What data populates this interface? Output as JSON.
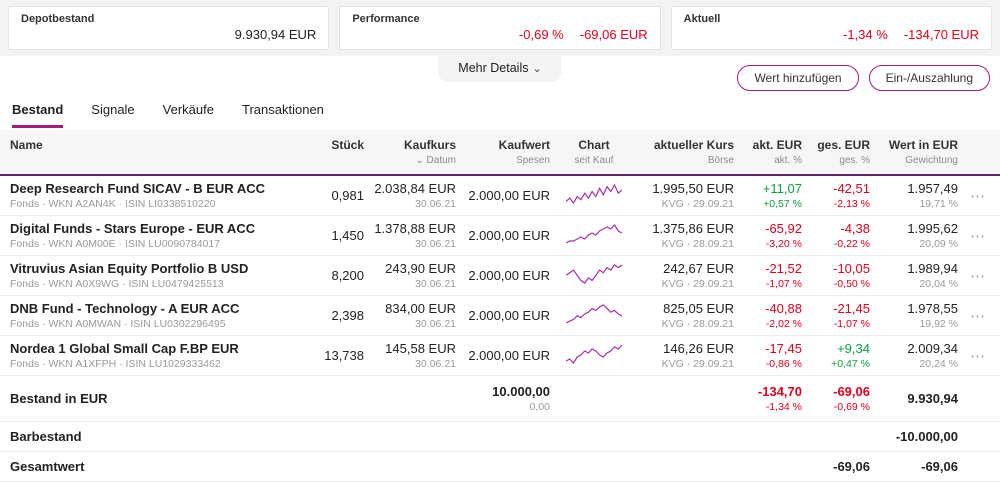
{
  "colors": {
    "accent": "#a61c7d",
    "positive": "#0aa13b",
    "negative": "#e2001a",
    "header_rule": "#5c2462",
    "spark": "#a330a8"
  },
  "summary": {
    "depot": {
      "label": "Depotbestand",
      "value": "9.930,94 EUR"
    },
    "performance": {
      "label": "Performance",
      "percent": "-0,69 %",
      "value": "-69,06 EUR"
    },
    "aktuell": {
      "label": "Aktuell",
      "percent": "-1,34 %",
      "value": "-134,70 EUR"
    }
  },
  "more_details": {
    "label": "Mehr Details",
    "chevron": "⌄"
  },
  "actions": {
    "add_value": "Wert hinzufügen",
    "deposit": "Ein-/Auszahlung"
  },
  "tabs": [
    {
      "label": "Bestand"
    },
    {
      "label": "Signale"
    },
    {
      "label": "Verkäufe"
    },
    {
      "label": "Transaktionen"
    }
  ],
  "table": {
    "menu_icon": "⋯",
    "headers": {
      "name": "Name",
      "stueck": "Stück",
      "kaufkurs": "Kaufkurs",
      "kaufkurs_sub": "⌄ Datum",
      "kaufwert": "Kaufwert",
      "kaufwert_sub": "Spesen",
      "chart": "Chart",
      "chart_sub": "seit Kauf",
      "kurs": "aktueller Kurs",
      "kurs_sub": "Börse",
      "akt": "akt. EUR",
      "akt_sub": "akt. %",
      "ges": "ges. EUR",
      "ges_sub": "ges. %",
      "wert": "Wert in EUR",
      "wert_sub": "Gewichtung"
    },
    "rows": [
      {
        "name": "Deep Research Fund SICAV - B EUR ACC",
        "meta": "Fonds · WKN A2AN4K · ISIN LI0338510220",
        "stueck": "0,981",
        "kaufkurs": "2.038,84 EUR",
        "kaufdatum": "30.06.21",
        "kaufwert": "2.000,00 EUR",
        "spark": [
          3,
          5,
          2,
          6,
          4,
          8,
          5,
          9,
          6,
          11,
          7,
          12,
          9,
          13,
          8,
          10
        ],
        "kurs": "1.995,50 EUR",
        "kurs_sub": "KVG · 29.09.21",
        "akt": "+11,07",
        "akt_pct": "+0,57 %",
        "ges": "-42,51",
        "ges_pct": "-2,13 %",
        "wert": "1.957,49",
        "gewichtung": "19,71 %"
      },
      {
        "name": "Digital Funds - Stars Europe - EUR ACC",
        "meta": "Fonds · WKN A0M00E · ISIN LU0090784017",
        "stueck": "1,450",
        "kaufkurs": "1.378,88 EUR",
        "kaufdatum": "30.06.21",
        "kaufwert": "2.000,00 EUR",
        "spark": [
          2,
          3,
          3,
          4,
          5,
          4,
          6,
          7,
          6,
          8,
          9,
          10,
          9,
          11,
          8,
          7
        ],
        "kurs": "1.375,86 EUR",
        "kurs_sub": "KVG · 28.09.21",
        "akt": "-65,92",
        "akt_pct": "-3,20 %",
        "ges": "-4,38",
        "ges_pct": "-0,22 %",
        "wert": "1.995,62",
        "gewichtung": "20,09 %"
      },
      {
        "name": "Vitruvius Asian Equity Portfolio B USD",
        "meta": "Fonds · WKN A0X9WG · ISIN LU0479425513",
        "stueck": "8,200",
        "kaufkurs": "243,90 EUR",
        "kaufdatum": "30.06.21",
        "kaufwert": "2.000,00 EUR",
        "spark": [
          5,
          6,
          7,
          5,
          3,
          2,
          4,
          3,
          5,
          7,
          6,
          8,
          7,
          9,
          8,
          9
        ],
        "kurs": "242,67 EUR",
        "kurs_sub": "KVG · 29.09.21",
        "akt": "-21,52",
        "akt_pct": "-1,07 %",
        "ges": "-10,05",
        "ges_pct": "-0,50 %",
        "wert": "1.989,94",
        "gewichtung": "20,04 %"
      },
      {
        "name": "DNB Fund - Technology - A EUR ACC",
        "meta": "Fonds · WKN A0MWAN · ISIN LU0302296495",
        "stueck": "2,398",
        "kaufkurs": "834,00 EUR",
        "kaufdatum": "30.06.21",
        "kaufwert": "2.000,00 EUR",
        "spark": [
          2,
          3,
          4,
          6,
          5,
          7,
          8,
          10,
          9,
          11,
          12,
          10,
          8,
          9,
          7,
          6
        ],
        "kurs": "825,05 EUR",
        "kurs_sub": "KVG · 28.09.21",
        "akt": "-40,88",
        "akt_pct": "-2,02 %",
        "ges": "-21,45",
        "ges_pct": "-1,07 %",
        "wert": "1.978,55",
        "gewichtung": "19,92 %"
      },
      {
        "name": "Nordea 1 Global Small Cap F.BP EUR",
        "meta": "Fonds · WKN A1XFPH · ISIN LU1029333462",
        "stueck": "13,738",
        "kaufkurs": "145,58 EUR",
        "kaufdatum": "30.06.21",
        "kaufwert": "2.000,00 EUR",
        "spark": [
          4,
          5,
          3,
          6,
          7,
          9,
          8,
          10,
          9,
          7,
          6,
          8,
          9,
          11,
          10,
          12
        ],
        "kurs": "146,26 EUR",
        "kurs_sub": "KVG · 29.09.21",
        "akt": "-17,45",
        "akt_pct": "-0,86 %",
        "ges": "+9,34",
        "ges_pct": "+0,47 %",
        "wert": "2.009,34",
        "gewichtung": "20,24 %"
      }
    ],
    "totals": {
      "bestand": {
        "label": "Bestand in EUR",
        "kaufwert": "10.000,00",
        "spesen": "0,00",
        "akt": "-134,70",
        "akt_pct": "-1,34 %",
        "ges": "-69,06",
        "ges_pct": "-0,69 %",
        "wert": "9.930,94"
      },
      "barbestand": {
        "label": "Barbestand",
        "wert": "-10.000,00"
      },
      "gesamtwert": {
        "label": "Gesamtwert",
        "ges": "-69,06",
        "wert": "-69,06"
      }
    }
  }
}
